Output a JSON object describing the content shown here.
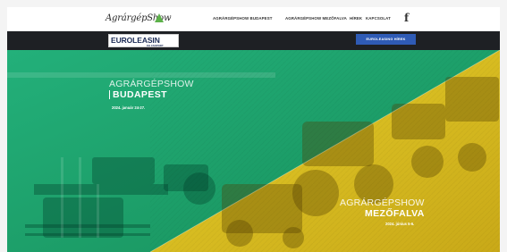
{
  "header": {
    "logo_text": "AgrárgépShow",
    "nav": [
      {
        "label": "AGRÁRGÉPSHOW BUDAPEST"
      },
      {
        "label": "AGRÁRGÉPSHOW MEZŐFALVA"
      },
      {
        "label": "HÍREK"
      },
      {
        "label": "KAPCSOLAT"
      }
    ],
    "facebook_glyph": "f"
  },
  "sponsor": {
    "logo_main": "EUROLEASIN",
    "logo_sub": "KH CSOPORT",
    "button_label": "EUROLEASING HÍREK"
  },
  "hero": {
    "budapest": {
      "title_line1": "AGRÁRGÉPSHOW",
      "title_line2": "BUDAPEST",
      "date": "2024. január 24-27."
    },
    "mezofalva": {
      "title_line1": "AGRÁRGÉPSHOW",
      "title_line2": "MEZŐFALVA",
      "date": "2024. június 5-6."
    }
  },
  "colors": {
    "green_overlay": "#1fa66a",
    "yellow_overlay": "#e2c61f",
    "topbar_bg": "#ffffff",
    "sponsorbar_bg": "#1e2024",
    "button_bg": "#2f5bb5"
  }
}
